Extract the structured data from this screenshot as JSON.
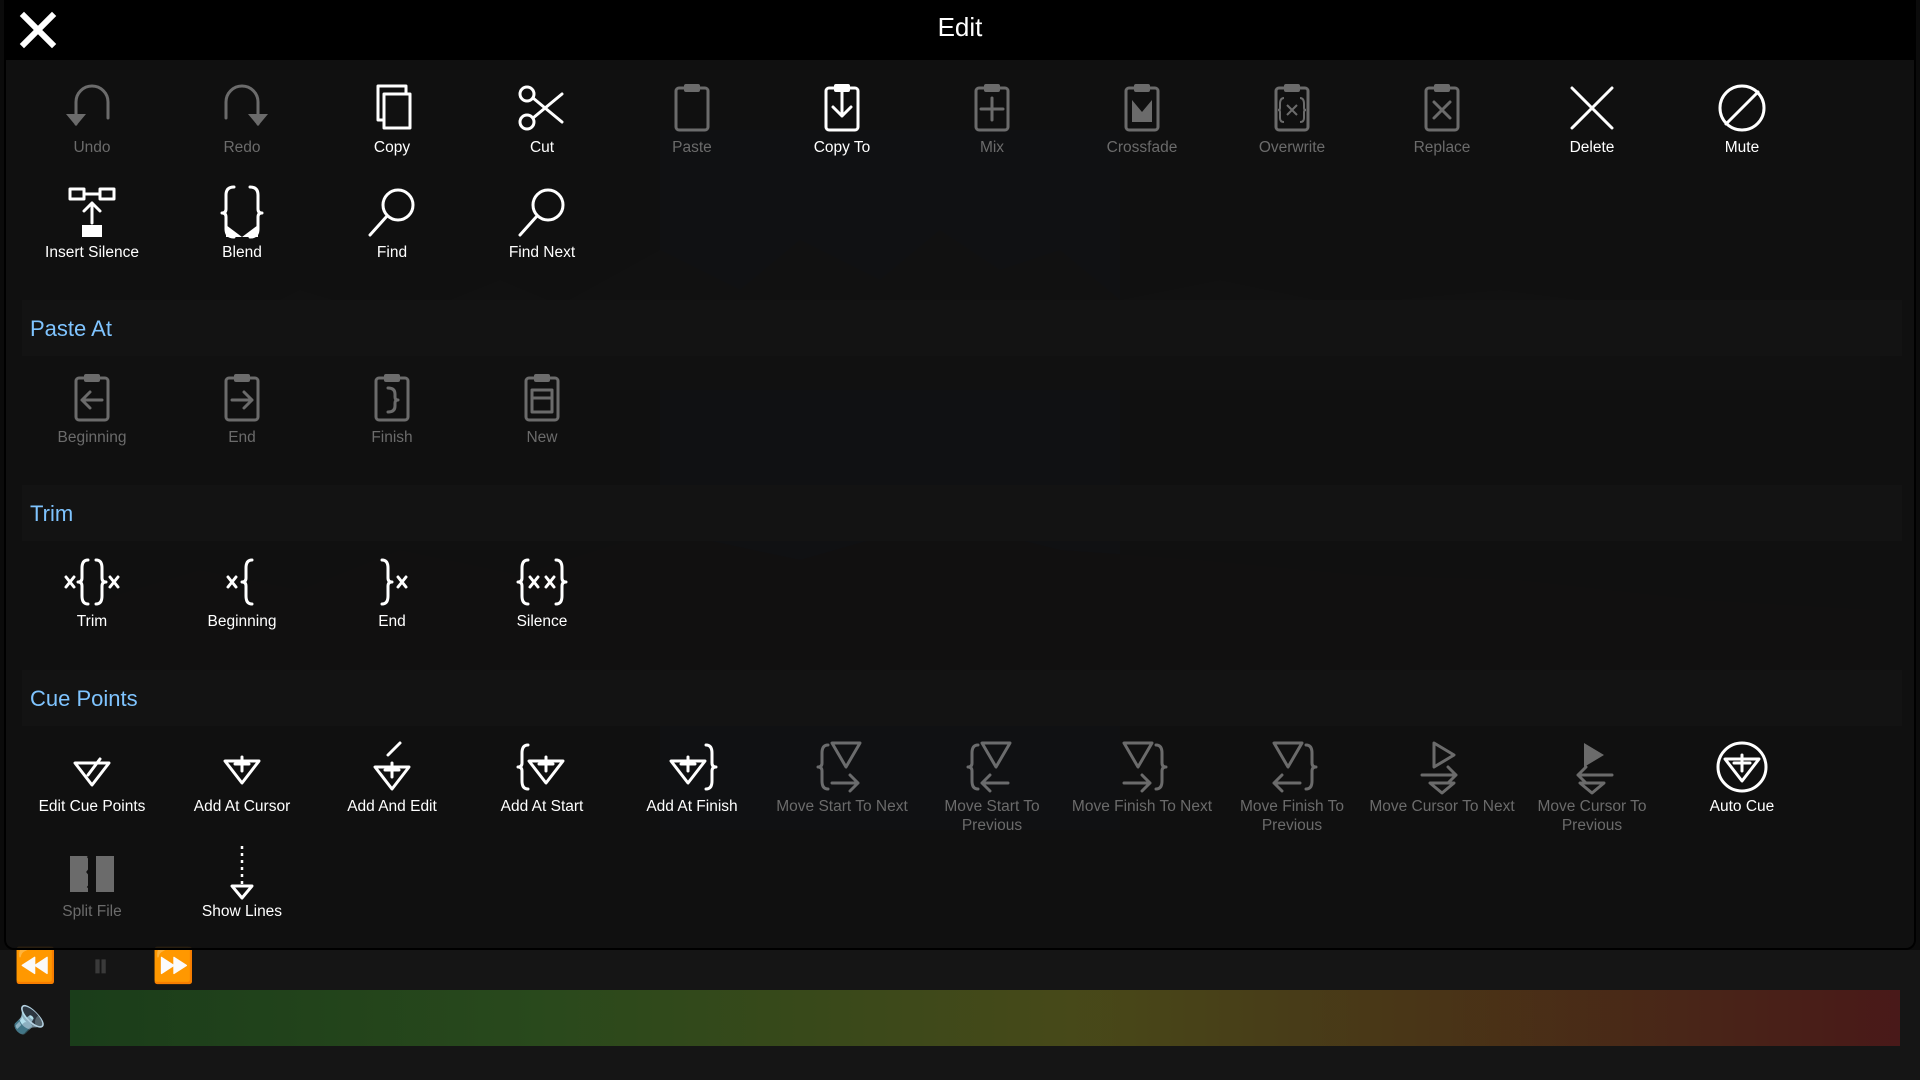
{
  "dialog": {
    "title": "Edit"
  },
  "toolbar_row1": [
    {
      "label": "Undo",
      "icon": "undo-icon",
      "enabled": false
    },
    {
      "label": "Redo",
      "icon": "redo-icon",
      "enabled": false
    },
    {
      "label": "Copy",
      "icon": "copy-icon",
      "enabled": true
    },
    {
      "label": "Cut",
      "icon": "scissors-icon",
      "enabled": true
    },
    {
      "label": "Paste",
      "icon": "clipboard-icon",
      "enabled": false
    },
    {
      "label": "Copy To",
      "icon": "clipboard-download-icon",
      "enabled": true
    },
    {
      "label": "Mix",
      "icon": "clipboard-plus-icon",
      "enabled": false
    },
    {
      "label": "Crossfade",
      "icon": "clipboard-crossfade-icon",
      "enabled": false
    },
    {
      "label": "Overwrite",
      "icon": "clipboard-brace-x-icon",
      "enabled": false
    },
    {
      "label": "Replace",
      "icon": "clipboard-x-icon",
      "enabled": false
    },
    {
      "label": "Delete",
      "icon": "x-icon",
      "enabled": true
    },
    {
      "label": "Mute",
      "icon": "slashed-circle-icon",
      "enabled": true
    }
  ],
  "toolbar_row2": [
    {
      "label": "Insert Silence",
      "icon": "insert-silence-icon",
      "enabled": true
    },
    {
      "label": "Blend",
      "icon": "blend-brace-icon",
      "enabled": true
    },
    {
      "label": "Find",
      "icon": "magnifier-icon",
      "enabled": true
    },
    {
      "label": "Find Next",
      "icon": "magnifier-next-icon",
      "enabled": true
    }
  ],
  "sections": {
    "paste_at": {
      "title": "Paste At",
      "items": [
        {
          "label": "Beginning",
          "icon": "clipboard-arrow-left-icon",
          "enabled": false
        },
        {
          "label": "End",
          "icon": "clipboard-arrow-right-icon",
          "enabled": false
        },
        {
          "label": "Finish",
          "icon": "clipboard-brace-icon",
          "enabled": false
        },
        {
          "label": "New",
          "icon": "clipboard-new-icon",
          "enabled": false
        }
      ]
    },
    "trim": {
      "title": "Trim",
      "items": [
        {
          "label": "Trim",
          "icon": "trim-icon",
          "enabled": true
        },
        {
          "label": "Beginning",
          "icon": "trim-beginning-icon",
          "enabled": true
        },
        {
          "label": "End",
          "icon": "trim-end-icon",
          "enabled": true
        },
        {
          "label": "Silence",
          "icon": "trim-silence-icon",
          "enabled": true
        }
      ]
    },
    "cue_points": {
      "title": "Cue Points",
      "items": [
        {
          "label": "Edit Cue Points",
          "icon": "cue-edit-icon",
          "enabled": true
        },
        {
          "label": "Add At Cursor",
          "icon": "cue-add-icon",
          "enabled": true
        },
        {
          "label": "Add And Edit",
          "icon": "cue-add-edit-icon",
          "enabled": true
        },
        {
          "label": "Add At Start",
          "icon": "cue-add-start-icon",
          "enabled": true
        },
        {
          "label": "Add At Finish",
          "icon": "cue-add-finish-icon",
          "enabled": true
        },
        {
          "label": "Move Start To Next",
          "icon": "cue-move-start-next-icon",
          "enabled": false
        },
        {
          "label": "Move Start To Previous",
          "icon": "cue-move-start-prev-icon",
          "enabled": false
        },
        {
          "label": "Move Finish To Next",
          "icon": "cue-move-finish-next-icon",
          "enabled": false
        },
        {
          "label": "Move Finish To Previous",
          "icon": "cue-move-finish-prev-icon",
          "enabled": false
        },
        {
          "label": "Move Cursor To Next",
          "icon": "cue-move-cursor-next-icon",
          "enabled": false
        },
        {
          "label": "Move Cursor To Previous",
          "icon": "cue-move-cursor-prev-icon",
          "enabled": false
        },
        {
          "label": "Auto Cue",
          "icon": "cue-auto-icon",
          "enabled": true
        }
      ],
      "extra": [
        {
          "label": "Split File",
          "icon": "split-file-icon",
          "enabled": false
        },
        {
          "label": "Show Lines",
          "icon": "show-lines-icon",
          "enabled": true
        }
      ]
    }
  },
  "colors": {
    "section_title": "#7fc4ff",
    "label_enabled": "#ffffff",
    "label_disabled": "#6b6b6b",
    "title_bar": "#000000"
  }
}
